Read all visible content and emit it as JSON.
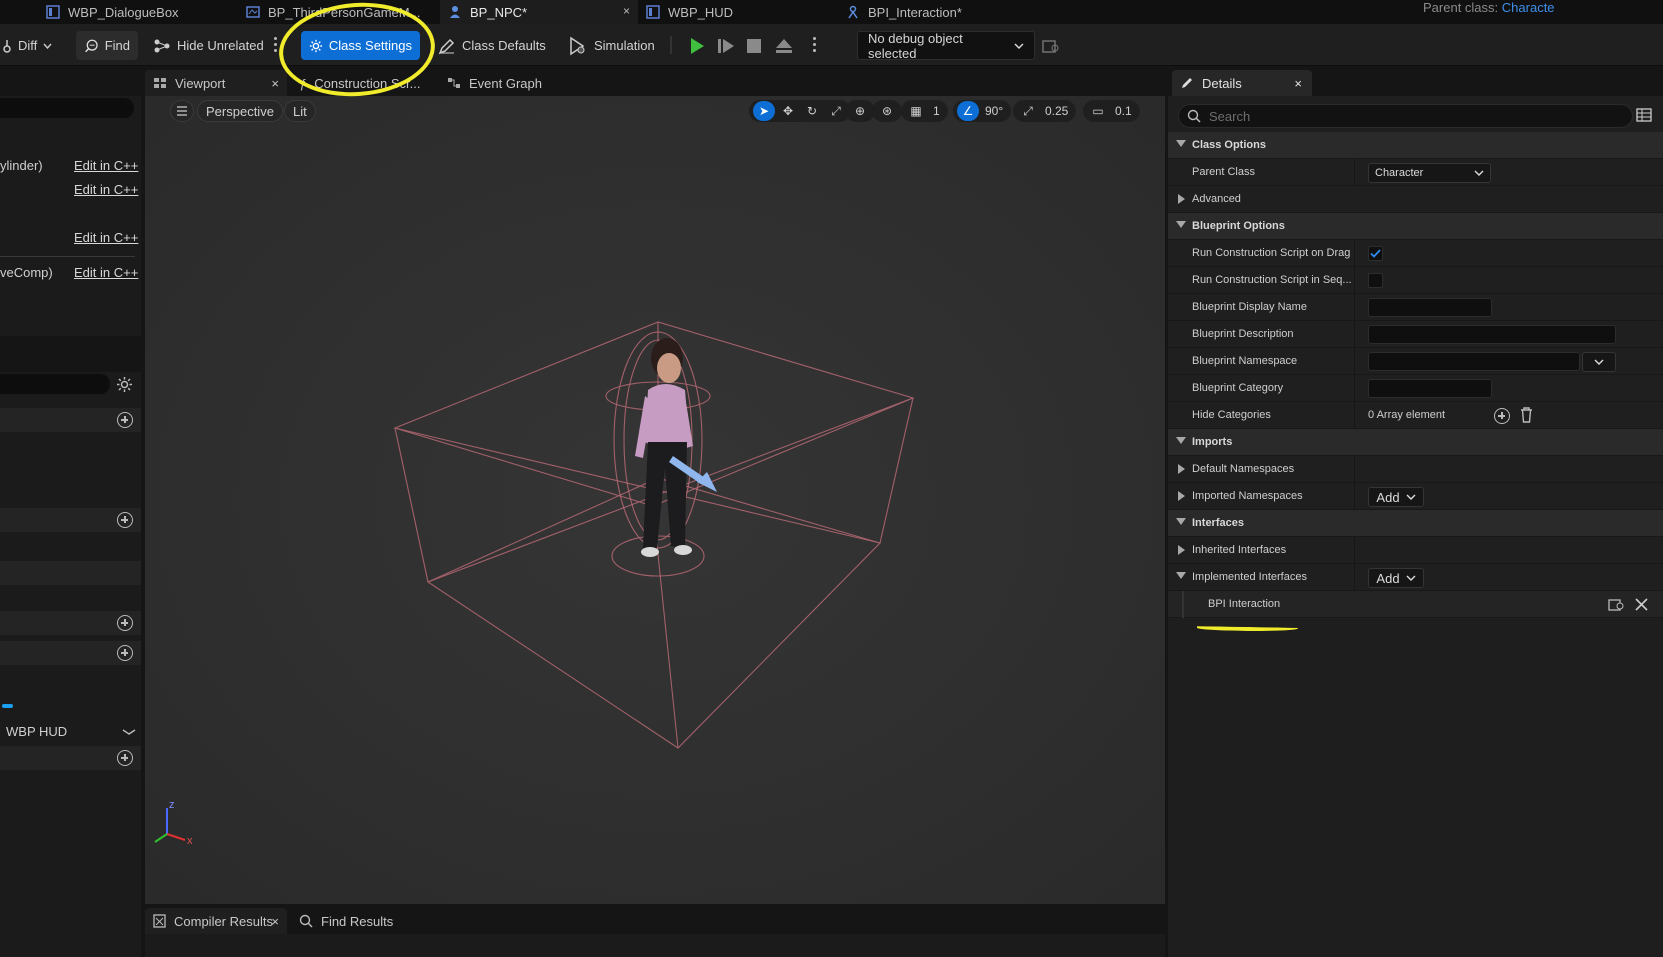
{
  "tabs": [
    {
      "label": "WBP_DialogueBox",
      "icon": "widget-blueprint-icon"
    },
    {
      "label": "BP_ThirdPersonGameM...",
      "icon": "blueprint-icon"
    },
    {
      "label": "BP_NPC*",
      "icon": "character-blueprint-icon",
      "active": true,
      "close": "×"
    },
    {
      "label": "WBP_HUD",
      "icon": "widget-blueprint-icon"
    },
    {
      "label": "BPI_Interaction*",
      "icon": "interface-icon"
    }
  ],
  "parent_class": {
    "label": "Parent class:",
    "value": "Characte"
  },
  "toolbar": {
    "diff": "Diff",
    "find": "Find",
    "hide_unrelated": "Hide Unrelated",
    "class_settings": "Class Settings",
    "class_defaults": "Class Defaults",
    "simulation": "Simulation",
    "debug_object": "No debug object selected"
  },
  "left_panel": {
    "rows": [
      {
        "label": "ylinder)",
        "link": "Edit in C++"
      },
      {
        "label": "",
        "link": "Edit in C++"
      },
      {
        "label": "",
        "link": "Edit in C++"
      },
      {
        "label": "veComp)",
        "link": "Edit in C++"
      }
    ],
    "hud_item": "WBP HUD"
  },
  "editor_tabs": [
    {
      "label": "Viewport",
      "close": "×"
    },
    {
      "label": "Construction Scr..."
    },
    {
      "label": "Event Graph"
    }
  ],
  "viewport": {
    "perspective": "Perspective",
    "lit": "Lit",
    "grid_value": "1",
    "angle_value": "90°",
    "scale_value": "0.25",
    "camera_speed": "0.1",
    "axis_x": "x",
    "axis_z": "z"
  },
  "bottom_tabs": [
    {
      "label": "Compiler Results",
      "close": "×"
    },
    {
      "label": "Find Results"
    }
  ],
  "details": {
    "title": "Details",
    "close": "×",
    "search_placeholder": "Search",
    "sections": {
      "class_options": "Class Options",
      "blueprint_options": "Blueprint Options",
      "imports": "Imports",
      "interfaces": "Interfaces"
    },
    "props": {
      "parent_class": "Parent Class",
      "parent_class_value": "Character",
      "advanced": "Advanced",
      "run_cs_on_drag": "Run Construction Script on Drag",
      "run_cs_on_drag_checked": true,
      "run_cs_in_seq": "Run Construction Script in Seq...",
      "run_cs_in_seq_checked": false,
      "display_name": "Blueprint Display Name",
      "description": "Blueprint Description",
      "namespace": "Blueprint Namespace",
      "category": "Blueprint Category",
      "hide_categories": "Hide Categories",
      "hide_categories_value": "0 Array element",
      "default_namespaces": "Default Namespaces",
      "imported_namespaces": "Imported Namespaces",
      "inherited_interfaces": "Inherited Interfaces",
      "implemented_interfaces": "Implemented Interfaces",
      "bpi_interaction": "BPI Interaction",
      "add": "Add"
    }
  },
  "colors": {
    "accent_blue": "#0d6fd6",
    "annotation_yellow": "#f0eb2b",
    "play_green": "#3fbe3f",
    "bounds_pink": "#c8707d"
  }
}
